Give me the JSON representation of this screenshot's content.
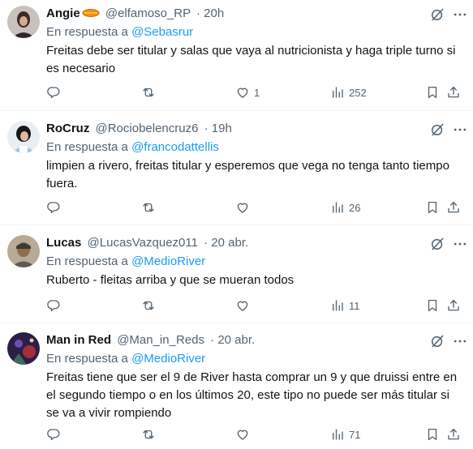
{
  "tweets": [
    {
      "name": "Angie",
      "handle": "@elfamoso_RP",
      "time": "· 20h",
      "reply_prefix": "En respuesta a ",
      "reply_to": "@Sebasrur",
      "text": "Freitas debe ser titular y salas que vaya al nutricionista y haga triple turno si es necesario",
      "replies": "",
      "reposts": "",
      "likes": "1",
      "views": "252"
    },
    {
      "name": "RoCruz",
      "handle": "@Rociobelencruz6",
      "time": "· 19h",
      "reply_prefix": "En respuesta a ",
      "reply_to": "@francodattellis",
      "text": "limpien a rivero, freitas titular y esperemos que vega no tenga tanto tiempo fuera.",
      "replies": "",
      "reposts": "",
      "likes": "",
      "views": "26"
    },
    {
      "name": "Lucas",
      "handle": "@LucasVazquez011",
      "time": "· 20 abr.",
      "reply_prefix": "En respuesta a ",
      "reply_to": "@MedioRiver",
      "text": "Ruberto - fleitas arriba y que se mueran todos",
      "replies": "",
      "reposts": "",
      "likes": "",
      "views": "11"
    },
    {
      "name": "Man in Red",
      "handle": "@Man_in_Reds",
      "time": "· 20 abr.",
      "reply_prefix": "En respuesta a ",
      "reply_to": "@MedioRiver",
      "text": "Freitas tiene que ser el 9 de River hasta comprar un 9 y que druissi entre en el segundo tiempo o en los últimos 20, este tipo no puede ser más titular si se va a vivir rompiendo",
      "replies": "",
      "reposts": "",
      "likes": "",
      "views": "71"
    }
  ],
  "colors": {
    "text": "#0f1419",
    "muted": "#536471",
    "link": "#1d9bf0",
    "divider": "#eff3f4",
    "badge": "#f4900c"
  },
  "icons": [
    "reply-icon",
    "repost-icon",
    "like-icon",
    "views-icon",
    "bookmark-icon",
    "share-icon",
    "grok-icon",
    "more-icon"
  ]
}
